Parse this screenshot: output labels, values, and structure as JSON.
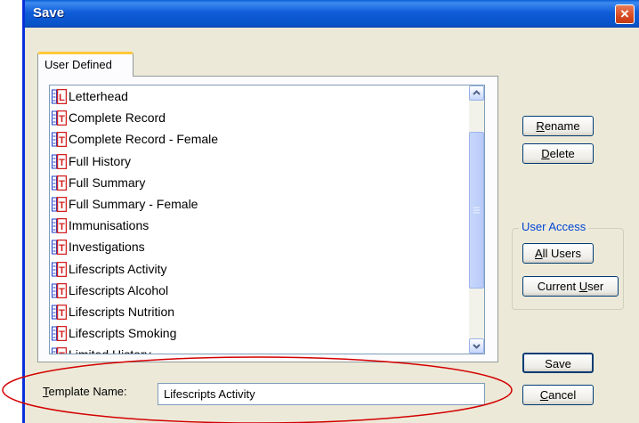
{
  "window": {
    "title": "Save",
    "close_icon": "×"
  },
  "tabs": [
    {
      "label": "User Defined"
    }
  ],
  "templates": [
    {
      "label": "Letterhead",
      "icon": "L"
    },
    {
      "label": "Complete Record",
      "icon": "T"
    },
    {
      "label": "Complete Record - Female",
      "icon": "T"
    },
    {
      "label": "Full History",
      "icon": "T"
    },
    {
      "label": "Full Summary",
      "icon": "T"
    },
    {
      "label": "Full Summary - Female",
      "icon": "T"
    },
    {
      "label": "Immunisations",
      "icon": "T"
    },
    {
      "label": "Investigations",
      "icon": "T"
    },
    {
      "label": "Lifescripts Activity",
      "icon": "T"
    },
    {
      "label": "Lifescripts Alcohol",
      "icon": "T"
    },
    {
      "label": "Lifescripts Nutrition",
      "icon": "T"
    },
    {
      "label": "Lifescripts Smoking",
      "icon": "T"
    },
    {
      "label": "Limited History",
      "icon": "T"
    }
  ],
  "buttons": {
    "rename": {
      "mnemonic": "R",
      "rest": "ename"
    },
    "delete": {
      "mnemonic": "D",
      "rest": "elete"
    },
    "all_users": {
      "mnemonic": "A",
      "rest": "ll Users"
    },
    "current_user": {
      "prefix": "Current ",
      "mnemonic": "U",
      "rest": "ser"
    },
    "save": {
      "label": "Save"
    },
    "cancel": {
      "mnemonic": "C",
      "rest": "ancel"
    }
  },
  "user_access": {
    "label": "User Access"
  },
  "template_name": {
    "label_mnemonic": "T",
    "label_rest": "emplate Name:",
    "value": "Lifescripts Activity"
  },
  "colors": {
    "titlebar": "#0a5fd6",
    "annotation": "#d40000",
    "icon_red": "#d42020",
    "icon_blue": "#1c3fc8"
  }
}
